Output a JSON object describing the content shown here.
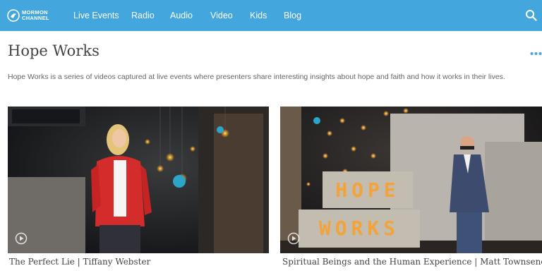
{
  "brand": {
    "line1": "MORMON",
    "line2": "CHANNEL"
  },
  "nav": {
    "items": [
      {
        "label": "Live Events"
      },
      {
        "label": "Radio"
      },
      {
        "label": "Audio"
      },
      {
        "label": "Video"
      },
      {
        "label": "Kids"
      },
      {
        "label": "Blog"
      }
    ]
  },
  "page": {
    "title": "Hope Works",
    "description": "Hope Works is a series of videos captured at live events where presenters share interesting insights about hope and faith and how it works in their lives."
  },
  "videos": [
    {
      "caption": "The Perfect Lie | Tiffany Webster"
    },
    {
      "caption": "Spiritual Beings and the Human Experience | Matt Townsend",
      "sign_top": "HOPE",
      "sign_bottom": "WORKS"
    }
  ],
  "colors": {
    "header_bg": "#43a6dd",
    "text": "#444444",
    "accent": "#43a6dd"
  },
  "icons": {
    "search": "search-icon",
    "more": "more-dots-icon",
    "play": "play-icon",
    "logo": "logo-icon"
  }
}
